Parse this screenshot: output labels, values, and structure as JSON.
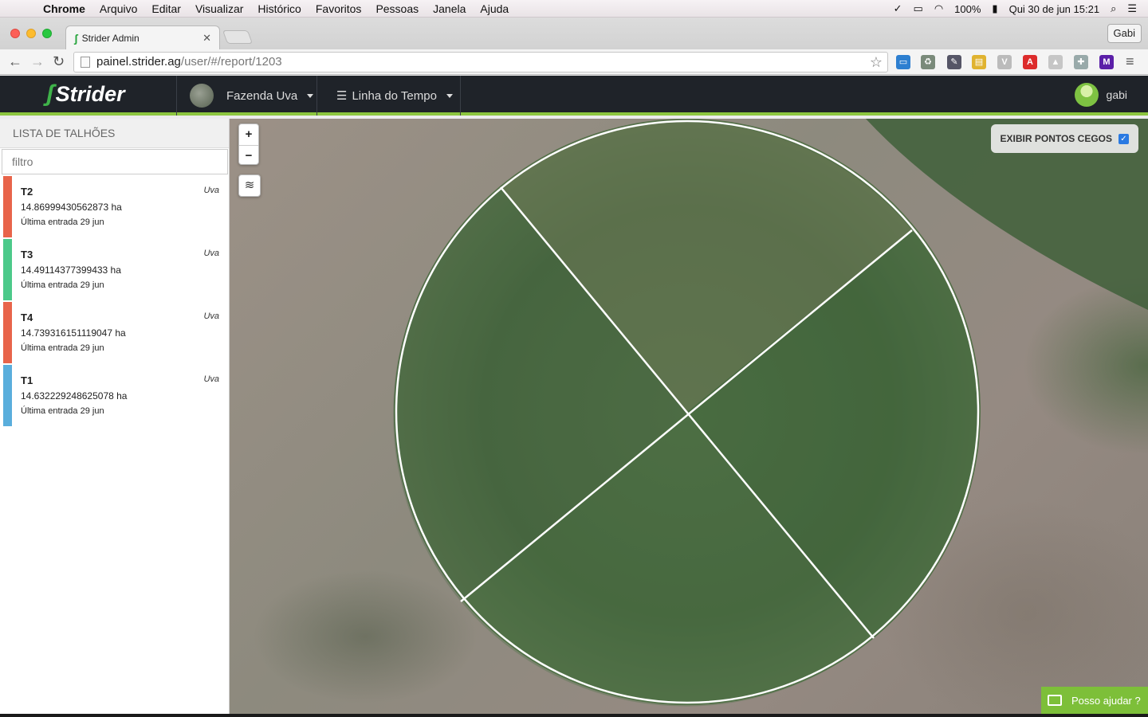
{
  "menubar": {
    "app": "Chrome",
    "items": [
      "Arquivo",
      "Editar",
      "Visualizar",
      "Histórico",
      "Favoritos",
      "Pessoas",
      "Janela",
      "Ajuda"
    ],
    "battery": "100%",
    "clock": "Qui 30 de jun  15:21"
  },
  "browser": {
    "tab_title": "Strider Admin",
    "profile": "Gabi",
    "url_host": "painel.strider.ag",
    "url_path": "/user/#/report/1203"
  },
  "header": {
    "brand": "Strider",
    "farm": "Fazenda Uva",
    "timeline": "Linha do Tempo",
    "user": "gabi"
  },
  "sidebar": {
    "title": "LISTA DE TALHÕES",
    "filter_placeholder": "filtro",
    "plots": [
      {
        "name": "T2",
        "area": "14.86999430562873 ha",
        "entry": "Última entrada 29 jun",
        "crop": "Uva",
        "color": "#e8644a"
      },
      {
        "name": "T3",
        "area": "14.49114377399433 ha",
        "entry": "Última entrada 29 jun",
        "crop": "Uva",
        "color": "#4cc98a"
      },
      {
        "name": "T4",
        "area": "14.739316151119047 ha",
        "entry": "Última entrada 29 jun",
        "crop": "Uva",
        "color": "#e8644a"
      },
      {
        "name": "T1",
        "area": "14.632229248625078 ha",
        "entry": "Última entrada 29 jun",
        "crop": "Uva",
        "color": "#5aaedc"
      }
    ]
  },
  "map": {
    "zoom_in": "+",
    "zoom_out": "−",
    "blind_spots_label": "EXIBIR PONTOS CEGOS",
    "blind_spots_checked": true,
    "help_label": "Posso ajudar ?"
  }
}
